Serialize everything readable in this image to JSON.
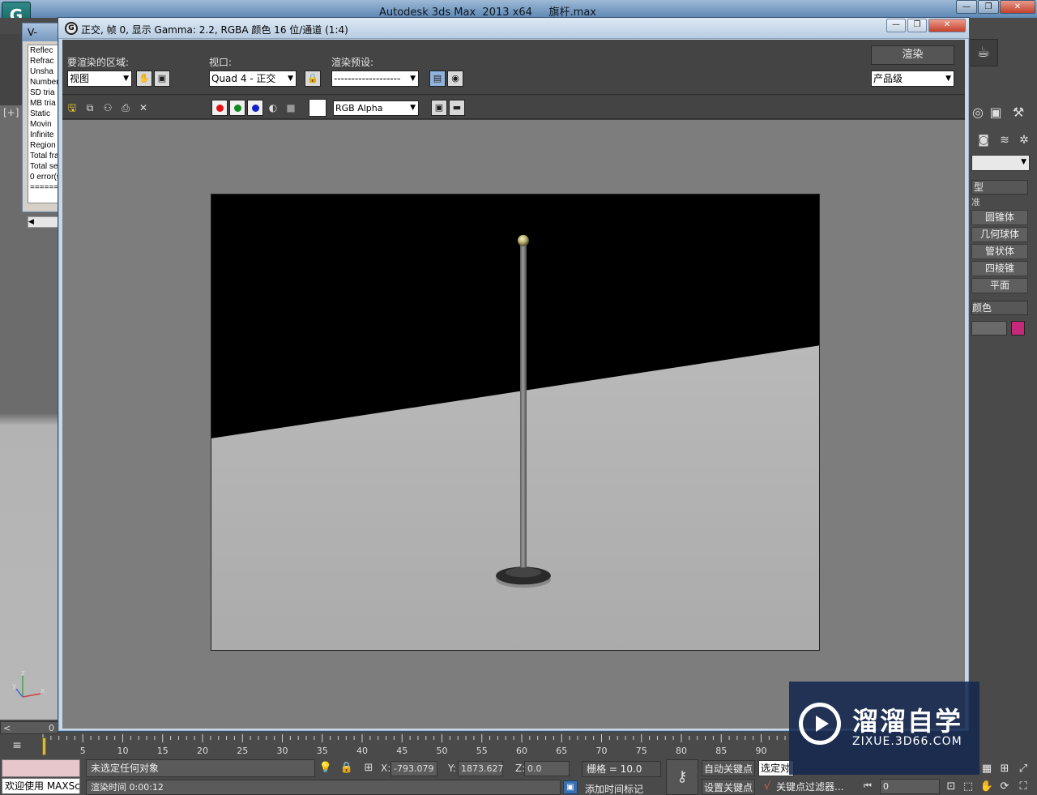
{
  "app": {
    "title": "Autodesk 3ds Max  2013 x64     旗杆.max",
    "logo_icon": "3dsmax-logo-icon",
    "window_buttons": [
      "—",
      "❐",
      "✕"
    ]
  },
  "viewport_left": {
    "label": "[+]",
    "axis": {
      "z": "z",
      "y": "y",
      "x": "x"
    }
  },
  "vray_log": {
    "title": "V-",
    "lines": [
      "Reflec",
      "Refrac",
      "Unsha",
      "Number",
      "SD tria",
      "MB tria",
      "Static",
      "Movin",
      "Infinite",
      "Region",
      "Total fra",
      "Total se",
      "0 error(s",
      "======"
    ],
    "scroll_left": "◀"
  },
  "frame_buffer": {
    "title": "正交, 帧 0, 显示 Gamma: 2.2, RGBA 颜色 16 位/通道 (1:4)",
    "window_buttons": [
      "—",
      "❐",
      "✕"
    ],
    "area_label": "要渲染的区域:",
    "area_value": "视图",
    "viewport_label": "视口:",
    "viewport_value": "Quad 4 - 正交",
    "preset_label": "渲染预设:",
    "preset_value": "-------------------",
    "render_button": "渲染",
    "quality_value": "产品级",
    "channel_value": "RGB Alpha",
    "channel_colors": {
      "red": "#e31010",
      "green": "#0f8a1f",
      "blue": "#1020d0"
    }
  },
  "command_panel": {
    "category_header": "型",
    "category_sub": "准",
    "buttons": [
      "圆锥体",
      "几何球体",
      "管状体",
      "四棱锥",
      "平面"
    ],
    "color_header": "颜色",
    "object_color": "#c8287a"
  },
  "timeline": {
    "slider_value": "0",
    "slider_arrow": "<",
    "ticks": [
      "5",
      "10",
      "15",
      "20",
      "25",
      "30",
      "35",
      "40",
      "45",
      "50",
      "55",
      "60",
      "65",
      "70",
      "75",
      "80",
      "85",
      "90"
    ]
  },
  "status": {
    "listener": "欢迎使用 MAXSc",
    "prompt": "未选定任何对象",
    "render_time": "渲染时间  0:00:12",
    "x_label": "X:",
    "x_value": "-793.079",
    "y_label": "Y:",
    "y_value": "1873.627",
    "z_label": "Z:",
    "z_value": "0.0",
    "grid": "栅格 = 10.0",
    "add_time_tag": "添加时间标记",
    "auto_key": "自动关键点",
    "set_key": "设置关键点",
    "selected": "选定对",
    "key_filters": "关键点过滤器...",
    "frame_value": "0"
  },
  "watermark": {
    "title": "溜溜自学",
    "url": "ZIXUE.3D66.COM"
  }
}
